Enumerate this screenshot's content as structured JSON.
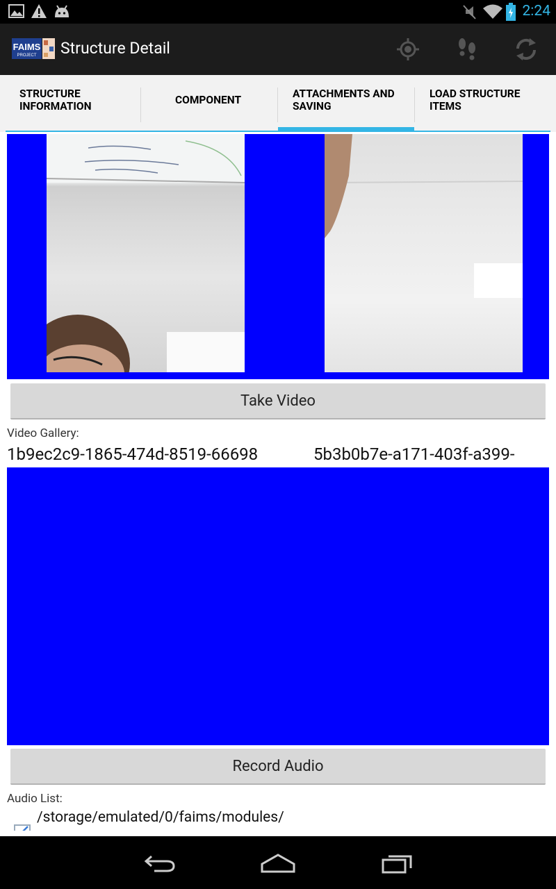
{
  "status_bar": {
    "time": "2:24"
  },
  "action_bar": {
    "logo_text": "FAIMS",
    "logo_sub": "PROJECT",
    "title": "Structure Detail"
  },
  "tabs": [
    {
      "label": "STRUCTURE INFORMATION",
      "line1": "STRUCTURE",
      "line2": "INFORMATION"
    },
    {
      "label": "COMPONENT",
      "line1": "COMPONENT",
      "line2": ""
    },
    {
      "label": "ATTACHMENTS AND SAVING",
      "line1": "ATTACHMENTS AND",
      "line2": "SAVING",
      "selected": true
    },
    {
      "label": "LOAD STRUCTURE ITEMS",
      "line1": "LOAD STRUCTURE",
      "line2": "ITEMS"
    }
  ],
  "content": {
    "take_video_label": "Take Video",
    "video_gallery_label": "Video Gallery:",
    "videos": [
      "1b9ec2c9-1865-474d-8519-66698",
      "5b3b0b7e-a171-403f-a399-"
    ],
    "record_audio_label": "Record Audio",
    "audio_list_label": "Audio List:",
    "audio_item_path": "/storage/emulated/0/faims/modules/"
  },
  "colors": {
    "accent": "#33b5e5",
    "gallery_bg": "#0000ff"
  }
}
